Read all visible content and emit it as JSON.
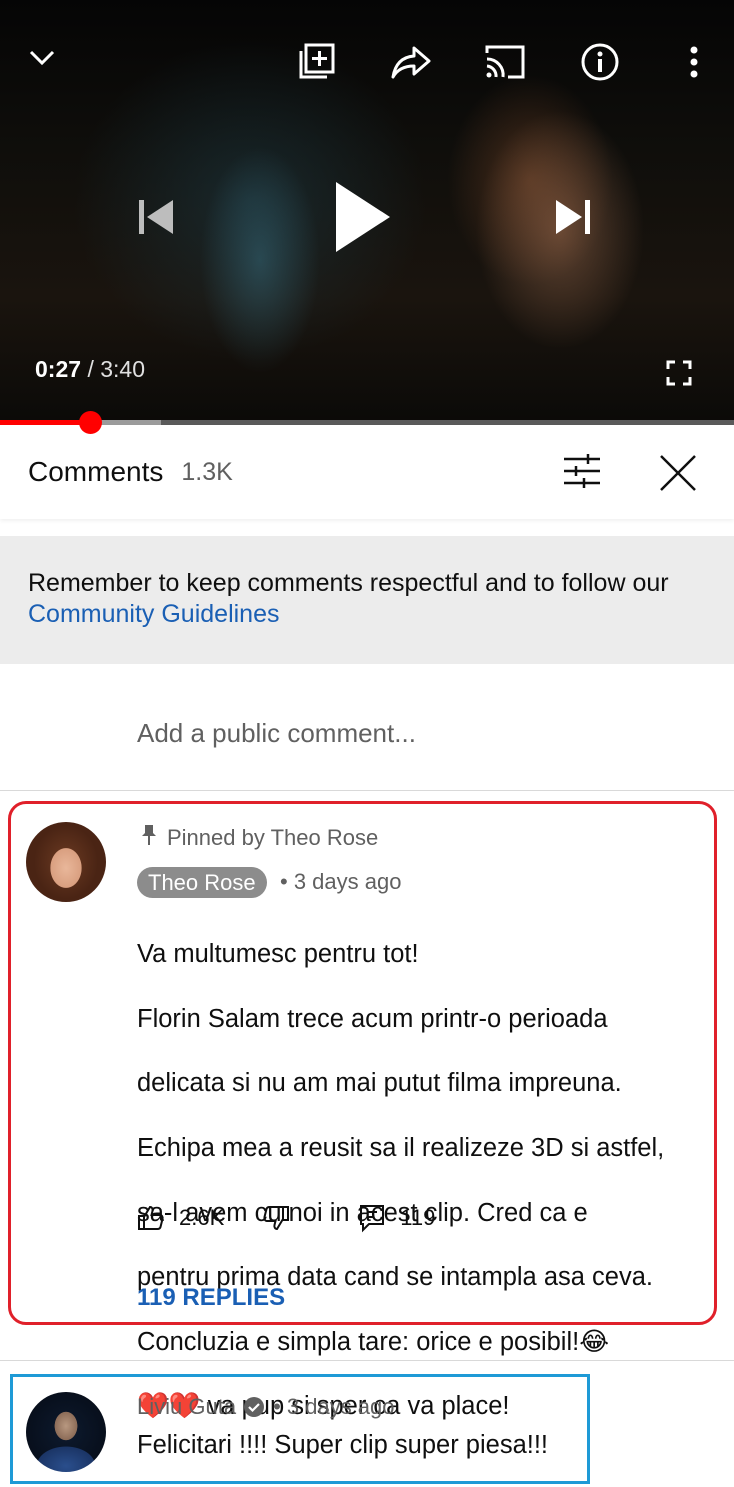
{
  "player": {
    "current_time": "0:27",
    "separator": "/",
    "duration": "3:40",
    "progress_fraction": 0.123,
    "buffered_fraction": 0.22,
    "icons": [
      "chevron-down-icon",
      "add-to-playlist-icon",
      "share-icon",
      "cast-icon",
      "info-icon",
      "more-vertical-icon",
      "previous-icon",
      "play-icon",
      "next-icon",
      "fullscreen-icon"
    ]
  },
  "comments_header": {
    "title": "Comments",
    "count": "1.3K"
  },
  "guidelines": {
    "text": "Remember to keep comments respectful and to follow our ",
    "link": "Community Guidelines"
  },
  "add_comment": {
    "placeholder": "Add a public comment..."
  },
  "pinned_comment": {
    "pinned_label": "Pinned by Theo Rose",
    "author": "Theo Rose",
    "time": "• 3 days ago",
    "lines": [
      "Va multumesc pentru tot!",
      "Florin Salam trece acum printr-o perioada",
      "delicata si nu am mai putut filma impreuna.",
      "Echipa mea a reusit sa il realizeze 3D si astfel,",
      "sa-l avem cu noi in acest clip. Cred ca e",
      "pentru prima data cand se intampla asa ceva.",
      "Concluzia e simpla tare: orice e posibil!😂",
      "❤️❤️ va pup si sper ca va place!"
    ],
    "likes": "2.6K",
    "reply_count": "119",
    "replies_link": "119 REPLIES"
  },
  "second_comment": {
    "author": "Liviu Guta",
    "time": "• 3 days ago",
    "text": "Felicitari !!!! Super clip super piesa!!!"
  },
  "colors": {
    "progress_red": "#ff0000",
    "link_blue": "#1a5fb4",
    "highlight_red": "#e0202a",
    "highlight_blue": "#1e9ad6"
  }
}
